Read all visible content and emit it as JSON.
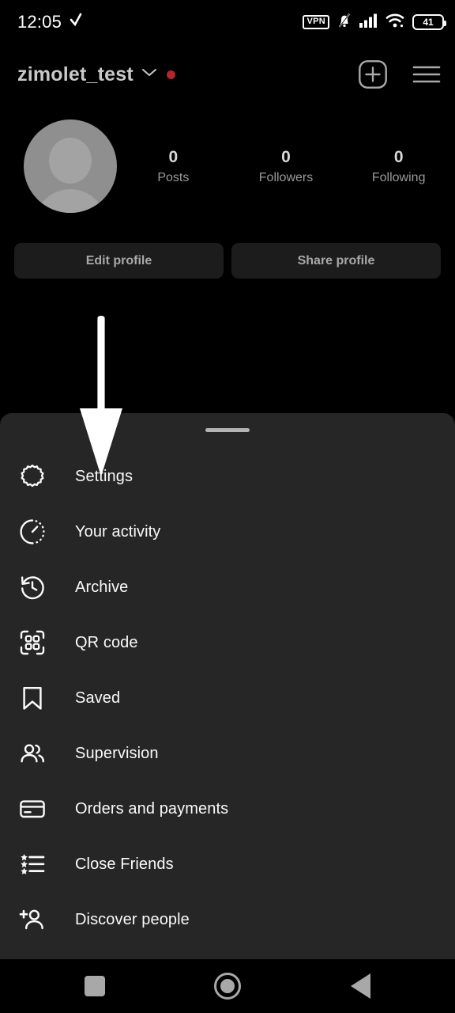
{
  "status_bar": {
    "time": "12:05",
    "left_icon": "checkmark-icon",
    "vpn_label": "VPN",
    "icons": [
      "notifications-muted-icon",
      "cellular-signal-icon",
      "wifi-icon"
    ],
    "battery_level": "41"
  },
  "header": {
    "username": "zimolet_test",
    "account_switch_icon": "chevron-down-icon",
    "unread_badge_color": "#b3252a",
    "create_icon": "plus-square-icon",
    "menu_icon": "hamburger-menu-icon"
  },
  "profile": {
    "avatar_icon": "default-avatar-icon",
    "stats": [
      {
        "value": "0",
        "label": "Posts"
      },
      {
        "value": "0",
        "label": "Followers"
      },
      {
        "value": "0",
        "label": "Following"
      }
    ],
    "buttons": [
      {
        "label": "Edit profile"
      },
      {
        "label": "Share profile"
      }
    ]
  },
  "sheet": {
    "handle": "drag-handle",
    "items": [
      {
        "label": "Settings",
        "icon": "gear-icon"
      },
      {
        "label": "Your activity",
        "icon": "activity-clock-icon"
      },
      {
        "label": "Archive",
        "icon": "archive-clock-rewind-icon"
      },
      {
        "label": "QR code",
        "icon": "qr-code-icon"
      },
      {
        "label": "Saved",
        "icon": "bookmark-icon"
      },
      {
        "label": "Supervision",
        "icon": "people-icon"
      },
      {
        "label": "Orders and payments",
        "icon": "credit-card-icon"
      },
      {
        "label": "Close Friends",
        "icon": "star-list-icon"
      },
      {
        "label": "Discover people",
        "icon": "person-add-icon"
      }
    ]
  },
  "annotation": {
    "arrow_icon": "down-arrow-pointer",
    "points_to": "Settings",
    "color": "#ffffff"
  },
  "nav_bar": {
    "buttons": [
      {
        "label": "Recents",
        "icon": "square-icon"
      },
      {
        "label": "Home",
        "icon": "circle-icon"
      },
      {
        "label": "Back",
        "icon": "triangle-left-icon"
      }
    ]
  },
  "colors": {
    "background": "#000000",
    "sheet_background": "#262626",
    "button_background": "#1c1c1c",
    "text_primary": "#fafafa",
    "text_secondary": "#9a9a9a"
  }
}
